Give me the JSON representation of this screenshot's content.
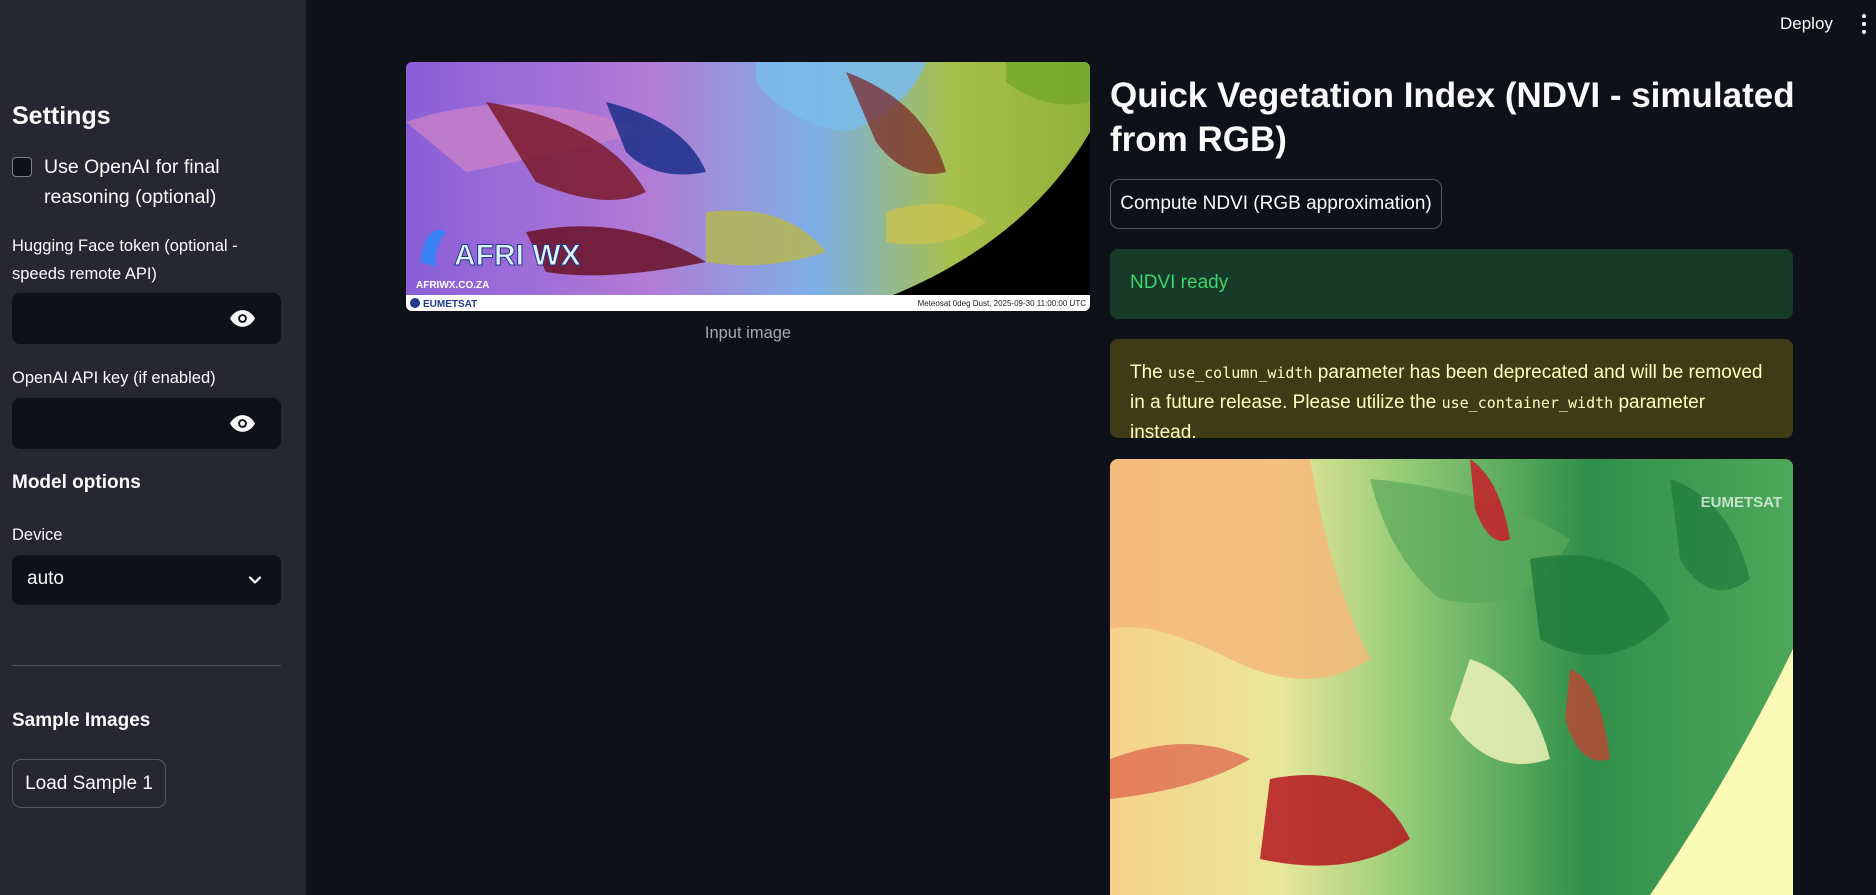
{
  "sidebar": {
    "settings_heading": "Settings",
    "openai_checkbox_label": "Use OpenAI for final reasoning (optional)",
    "hf_token_label": "Hugging Face token (optional - speeds remote API)",
    "openai_key_label": "OpenAI API key (if enabled)",
    "model_options_heading": "Model options",
    "device_label": "Device",
    "device_value": "auto",
    "sample_images_heading": "Sample Images",
    "load_sample_button": "Load Sample 1"
  },
  "header": {
    "deploy_label": "Deploy"
  },
  "main": {
    "input_image": {
      "logo_brand": "AFRI WX",
      "logo_url": "AFRIWX.CO.ZA",
      "footer_brand": "EUMETSAT",
      "footer_text": "Meteosat 0deg Dust, 2025-09-30 11:00:00 UTC",
      "caption": "Input image"
    },
    "title": "Quick Vegetation Index (NDVI - simulated from RGB)",
    "compute_button": "Compute NDVI (RGB approximation)",
    "success_message": "NDVI ready",
    "warning": {
      "part1": "The ",
      "code1": "use_column_width",
      "part2": " parameter has been deprecated and will be removed in a future release. Please utilize the ",
      "code2": "use_container_width",
      "part3": " parameter instead."
    },
    "ndvi_image": {
      "watermark": "EUMETSAT"
    }
  },
  "colors": {
    "app_background": "#0e1117",
    "sidebar_background": "#262730",
    "success_background": "#173928",
    "success_text": "#3dd56d",
    "warning_background": "#3e3b16",
    "warning_text": "#ffffc2"
  },
  "icons": {
    "password_toggle": "eye-icon",
    "select_toggle": "chevron-down-icon",
    "main_menu": "vertical-dots-icon"
  }
}
